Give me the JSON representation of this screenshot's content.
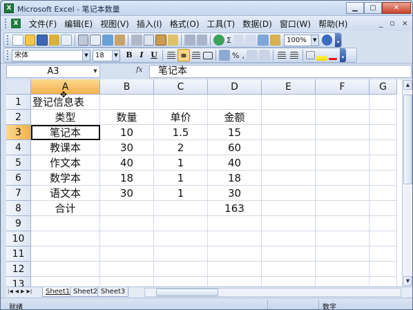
{
  "window": {
    "title": "Microsoft Excel - 笔记本数量",
    "app_icon": "X",
    "controls": {
      "minimize": "▁",
      "restore": "▢",
      "close": "✕"
    }
  },
  "menubar": {
    "items": [
      {
        "label": "文件(F)"
      },
      {
        "label": "编辑(E)"
      },
      {
        "label": "视图(V)"
      },
      {
        "label": "插入(I)"
      },
      {
        "label": "格式(O)"
      },
      {
        "label": "工具(T)"
      },
      {
        "label": "数据(D)"
      },
      {
        "label": "窗口(W)"
      },
      {
        "label": "帮助(H)"
      }
    ],
    "doc_controls": {
      "minimize": "_",
      "restore": "▫",
      "close": "×"
    }
  },
  "standard_toolbar": {
    "zoom_value": "100%",
    "sigma": "Σ",
    "icons": [
      "new-icon",
      "open-icon",
      "save-icon",
      "permission-icon",
      "email-icon",
      "print-icon",
      "print-preview-icon",
      "spelling-icon",
      "research-icon",
      "cut-icon",
      "copy-icon",
      "paste-icon",
      "format-painter-icon",
      "undo-icon",
      "redo-icon",
      "hyperlink-icon",
      "autosum-icon",
      "sort-asc-icon",
      "sort-desc-icon",
      "chart-wizard-icon",
      "drawing-icon",
      "help-icon"
    ]
  },
  "format_toolbar": {
    "font_name": "宋体",
    "font_size": "18",
    "bold": "B",
    "italic": "I",
    "underline": "U",
    "percent": "%",
    "comma": ","
  },
  "formula_bar": {
    "name_box": "A3",
    "fx": "fx",
    "content": "笔记本"
  },
  "grid": {
    "columns": [
      "A",
      "B",
      "C",
      "D",
      "E",
      "F",
      "G"
    ],
    "rows": [
      "1",
      "2",
      "3",
      "4",
      "5",
      "6",
      "7",
      "8",
      "9",
      "10",
      "11",
      "12",
      "13"
    ],
    "selected_cell": "A3",
    "cells": {
      "A1": "登记信息表",
      "A2": "类型",
      "B2": "数量",
      "C2": "单价",
      "D2": "金额",
      "A3": "笔记本",
      "B3": "10",
      "C3": "1.5",
      "D3": "15",
      "A4": "教课本",
      "B4": "30",
      "C4": "2",
      "D4": "60",
      "A5": "作文本",
      "B5": "40",
      "C5": "1",
      "D5": "40",
      "A6": "数学本",
      "B6": "18",
      "C6": "1",
      "D6": "18",
      "A7": "语文本",
      "B7": "30",
      "C7": "1",
      "D7": "30",
      "A8": "合计",
      "D8": "163"
    }
  },
  "sheet_tabs": [
    "Sheet1",
    "Sheet2",
    "Sheet3"
  ],
  "status": {
    "left": "就绪",
    "right": "数字"
  }
}
